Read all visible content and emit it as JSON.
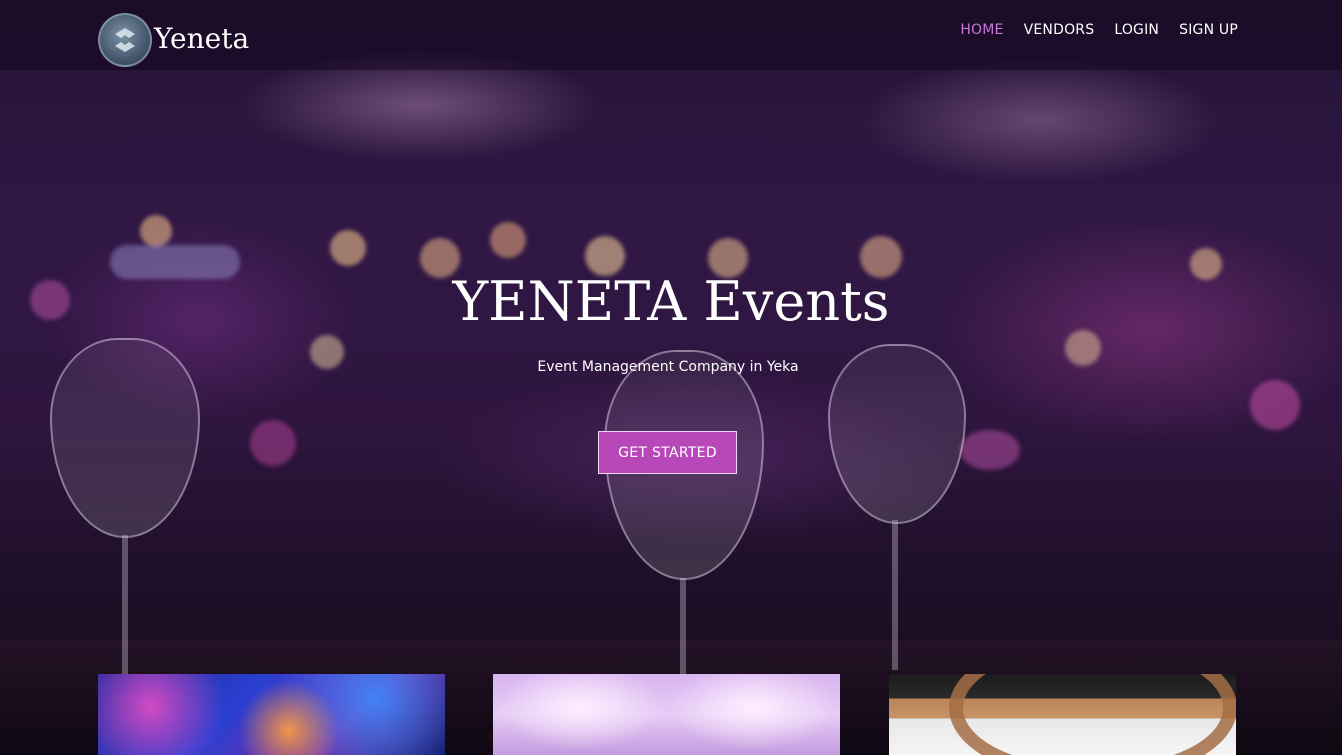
{
  "app": {
    "brand_name": "Yeneta",
    "accent_color": "#b848ba",
    "active_nav_color": "#c77bd6"
  },
  "nav": {
    "items": [
      {
        "label": "HOME",
        "active": true
      },
      {
        "label": "VENDORS",
        "active": false
      },
      {
        "label": "LOGIN",
        "active": false
      },
      {
        "label": "SIGN UP",
        "active": false
      }
    ]
  },
  "hero": {
    "title": "YENETA Events",
    "subtitle": "Event Management Company in Yeka",
    "cta_label": "GET STARTED"
  },
  "cards": [
    {
      "icon": "concert-lights-image"
    },
    {
      "icon": "wedding-drapes-image"
    },
    {
      "icon": "venue-ceiling-image"
    }
  ]
}
